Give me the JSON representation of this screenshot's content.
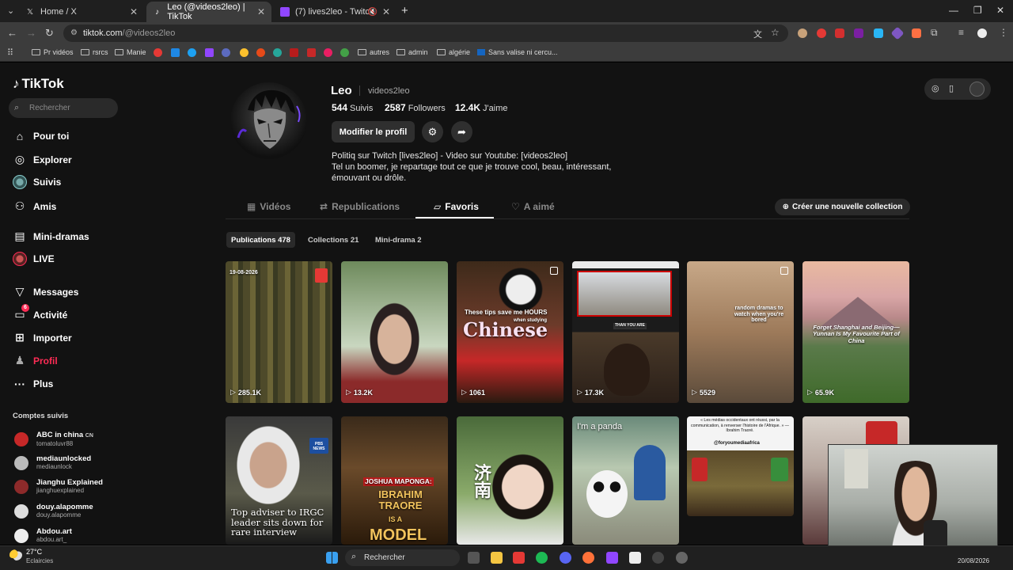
{
  "browser": {
    "tabs": [
      {
        "label": "Home / X"
      },
      {
        "label": "Leo (@videos2leo) | TikTok"
      },
      {
        "label": "(7) lives2leo - Twitch"
      }
    ],
    "url_host": "tiktok.com",
    "url_path": "/@videos2leo",
    "bookmarks": [
      "Pr vidéos",
      "rsrcs",
      "Manie",
      "autres",
      "admin",
      "algérie",
      "Sans valise ni cercu..."
    ]
  },
  "tiktok": {
    "logo": "TikTok",
    "search_placeholder": "Rechercher",
    "nav": [
      {
        "label": "Pour toi",
        "icon": "home-icon"
      },
      {
        "label": "Explorer",
        "icon": "compass-icon"
      },
      {
        "label": "Suivis",
        "icon": "following-avatar"
      },
      {
        "label": "Amis",
        "icon": "friends-icon"
      },
      {
        "label": "Mini-dramas",
        "icon": "film-icon"
      },
      {
        "label": "LIVE",
        "icon": "live-avatar"
      },
      {
        "label": "Messages",
        "icon": "message-icon"
      },
      {
        "label": "Activité",
        "icon": "activity-icon",
        "badge": "6"
      },
      {
        "label": "Importer",
        "icon": "upload-icon"
      },
      {
        "label": "Profil",
        "icon": "profile-icon"
      },
      {
        "label": "Plus",
        "icon": "more-icon"
      }
    ],
    "followed_title": "Comptes suivis",
    "followed": [
      {
        "name": "ABC in china",
        "tag": "CN",
        "handle": "tomatoluvr88"
      },
      {
        "name": "mediaunlocked",
        "tag": "",
        "handle": "mediaunlock"
      },
      {
        "name": "Jianghu Explained",
        "tag": "",
        "handle": "jianghuexplained"
      },
      {
        "name": "douy.alapomme",
        "tag": "",
        "handle": "douy.alapomme"
      },
      {
        "name": "Abdou.art",
        "tag": "",
        "handle": "abdou.art_"
      }
    ]
  },
  "profile": {
    "display_name": "Leo",
    "username": "videos2leo",
    "following_count": "544",
    "following_label": "Suivis",
    "followers_count": "2587",
    "followers_label": "Followers",
    "likes_count": "12.4K",
    "likes_label": "J'aime",
    "edit_button": "Modifier le profil",
    "bio_lines": [
      "Politiq sur Twitch [lives2leo] - Video sur Youtube: [videos2leo]",
      "Tel un boomer, je repartage tout ce que je trouve cool, beau, intéressant,",
      "émouvant ou drôle."
    ],
    "tabs": [
      "Vidéos",
      "Republications",
      "Favoris",
      "A aimé"
    ],
    "new_collection": "Créer une nouvelle collection",
    "chips": [
      "Publications 478",
      "Collections 21",
      "Mini-drama 2"
    ]
  },
  "grid": {
    "row1": [
      {
        "views": "285.1K",
        "date": "19-08-2026"
      },
      {
        "views": "13.2K"
      },
      {
        "views": "1061",
        "title_small": "These tips save me HOURS",
        "title_big": "Chinese",
        "title_small2": "when studying"
      },
      {
        "views": "17.3K",
        "caption": "THAN YOU ARE"
      },
      {
        "views": "5529",
        "caption": "random dramas to watch when you're bored"
      },
      {
        "views": "65.9K",
        "caption": "Forget Shanghai and Beijing— Yunnan Is My Favourite Part of China"
      }
    ],
    "row2": [
      {
        "caption": "Top adviser to IRGC leader sits down for rare interview",
        "badge": "PBS NEWS"
      },
      {
        "caption_top": "JOSHUA MAPONGA:",
        "caption_big": "IBRAHIM TRAORE",
        "caption_mid": "IS A",
        "caption_bot": "MODEL"
      },
      {
        "caption": "济南"
      },
      {
        "caption": "I'm a panda"
      },
      {
        "caption": "« Les médias occidentaux ont réussi, par la communication, à renverser l'histoire de l'Afrique. » — Ibrahim Traoré.",
        "handle": "@foryoumediaafrica"
      },
      {
        "caption": ""
      }
    ]
  },
  "taskbar": {
    "temp": "27°C",
    "weather": "Eclaircies",
    "search": "Rechercher",
    "date": "20/08/2026"
  }
}
